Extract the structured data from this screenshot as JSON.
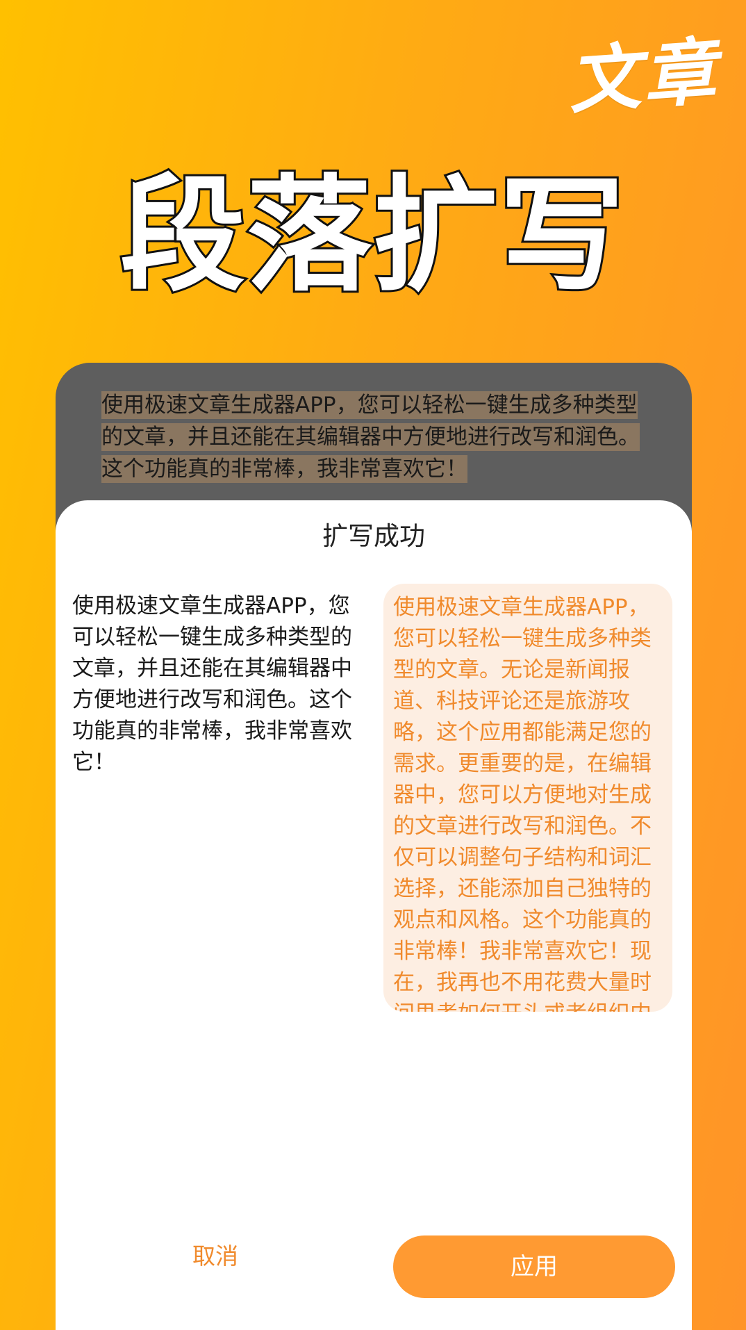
{
  "brand": {
    "mark": "文章"
  },
  "hero": {
    "title": "段落扩写"
  },
  "source": {
    "text": "使用极速文章生成器APP，您可以轻松一键生成多种类型的文章，并且还能在其编辑器中方便地进行改写和润色。这个功能真的非常棒，我非常喜欢它！"
  },
  "modal": {
    "title": "扩写成功",
    "original_text": "使用极速文章生成器APP，您可以轻松一键生成多种类型的文章，并且还能在其编辑器中方便地进行改写和润色。这个功能真的非常棒，我非常喜欢它！",
    "expanded_text": "使用极速文章生成器APP，您可以轻松一键生成多种类型的文章。无论是新闻报道、科技评论还是旅游攻略，这个应用都能满足您的需求。更重要的是，在编辑器中，您可以方便地对生成的文章进行改写和润色。不仅可以调整句子结构和词汇选择，还能添加自己独特的观点和风格。这个功能真的非常棒！我非常喜欢它！现在，我再也不用花费大量时间思考如何开头或者组织内容了。只需要点击几下按钮，就能得到一个完整且有逻辑性的文章草稿。而且，编辑器提供了各种格式选项和排版工具，使得最后呈现出来的文章看起来专业而精",
    "cancel_label": "取消",
    "apply_label": "应用"
  },
  "colors": {
    "accent": "#FF9A32",
    "accent_text": "#F08A2C",
    "expanded_bg": "#FDEEE2",
    "background_start": "#FFC000",
    "background_end": "#FF9428"
  }
}
